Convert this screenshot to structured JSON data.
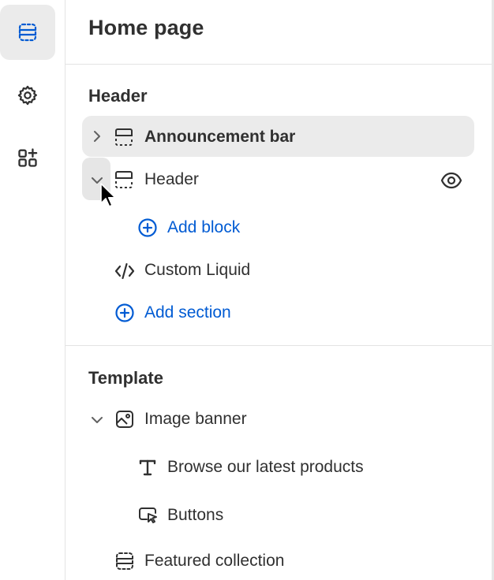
{
  "sidebar_rail": {
    "items": [
      {
        "name": "sections-icon",
        "active": true
      },
      {
        "name": "settings-gear-icon",
        "active": false
      },
      {
        "name": "apps-icon",
        "active": false
      }
    ]
  },
  "panel": {
    "title": "Home page",
    "header_group": {
      "title": "Header",
      "sections": [
        {
          "label": "Announcement bar",
          "expanded": false,
          "selected": true,
          "icon": "section-layout-icon"
        },
        {
          "label": "Header",
          "expanded": true,
          "selected": false,
          "icon": "section-layout-icon",
          "visibility_icon": "eye-icon",
          "add_block_label": "Add block"
        },
        {
          "label": "Custom Liquid",
          "icon": "code-icon"
        }
      ],
      "add_section_label": "Add section"
    },
    "template_group": {
      "title": "Template",
      "sections": [
        {
          "label": "Image banner",
          "expanded": true,
          "icon": "image-icon",
          "blocks": [
            {
              "label": "Browse our latest products",
              "icon": "text-icon"
            },
            {
              "label": "Buttons",
              "icon": "button-pointer-icon"
            }
          ]
        },
        {
          "label": "Featured collection",
          "icon": "section-layout-icon"
        }
      ]
    }
  },
  "colors": {
    "accent": "#005bd3",
    "text": "#303030",
    "selected_bg": "#ebebeb",
    "divider": "#e3e3e3"
  }
}
